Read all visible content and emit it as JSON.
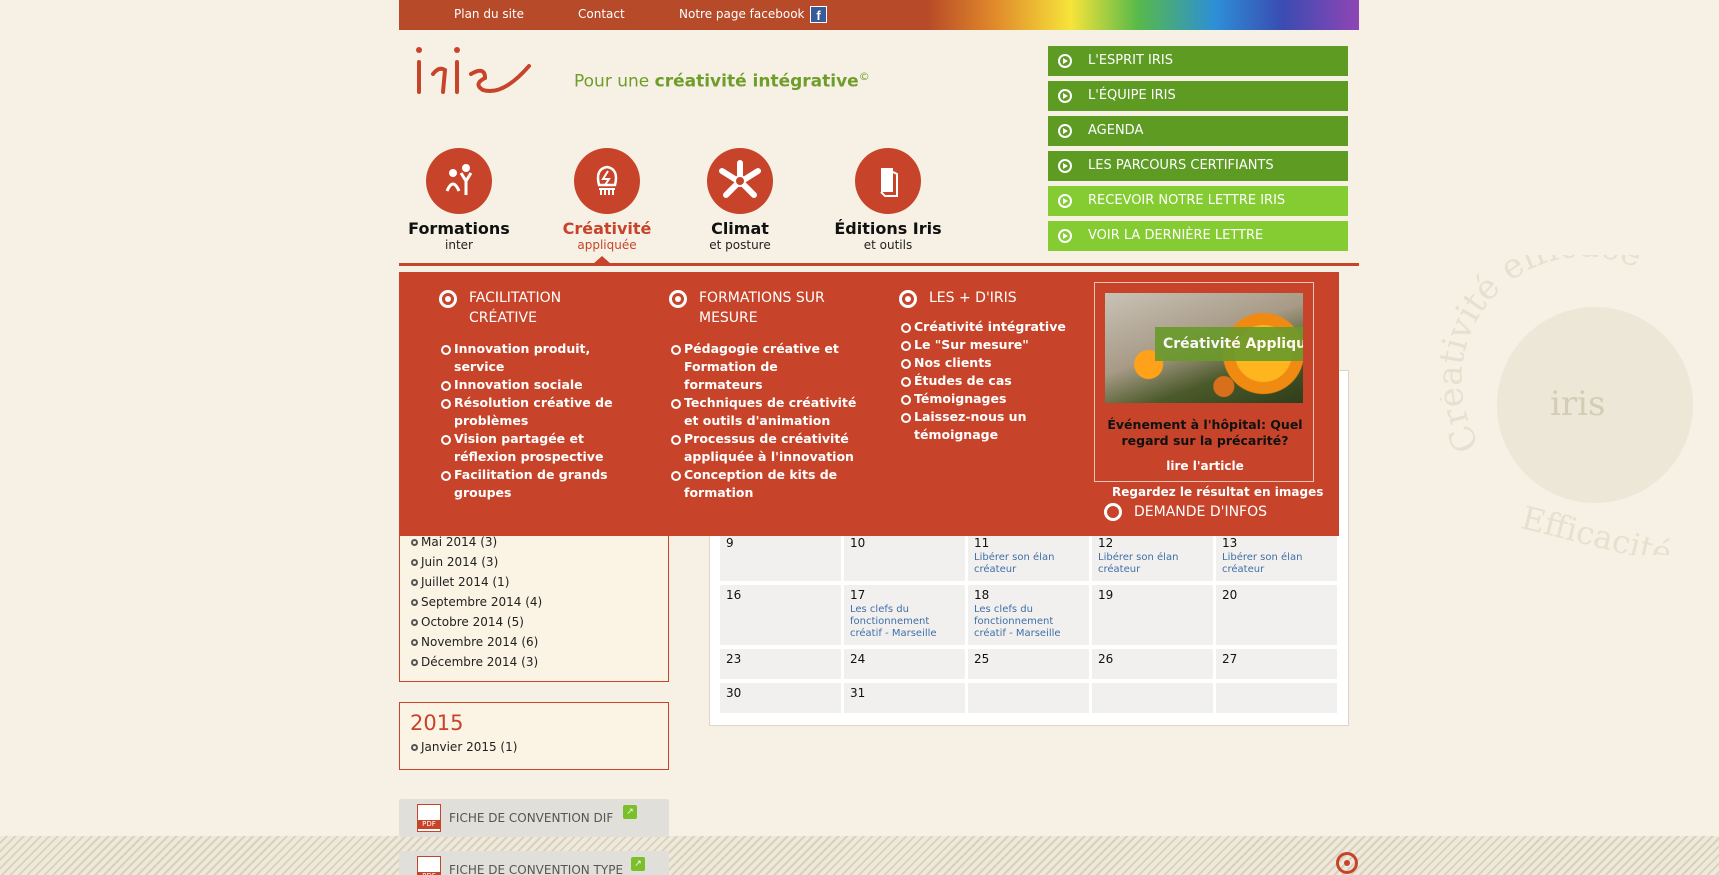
{
  "topbar": {
    "links": [
      "Plan du site",
      "Contact",
      "Notre page facebook"
    ],
    "facebook_icon": "facebook-icon"
  },
  "header": {
    "logo_text": "iris",
    "tagline_prefix": "Pour une ",
    "tagline_bold": "créativité intégrative",
    "tagline_mark": "©"
  },
  "side_menu": [
    {
      "label": "L'ESPRIT IRIS",
      "style": "dark"
    },
    {
      "label": "L'ÉQUIPE IRIS",
      "style": "dark"
    },
    {
      "label": "AGENDA",
      "style": "dark"
    },
    {
      "label": "LES PARCOURS CERTIFIANTS",
      "style": "dark"
    },
    {
      "label": "RECEVOIR NOTRE LETTRE IRIS",
      "style": "light"
    },
    {
      "label": "VOIR LA DERNIÈRE LETTRE",
      "style": "light"
    }
  ],
  "nav": [
    {
      "title": "Formations",
      "sub": "inter",
      "icon": "people-icon"
    },
    {
      "title": "Créativité",
      "sub": "appliquée",
      "icon": "lightbulb-icon",
      "active": true
    },
    {
      "title": "Climat",
      "sub": "et posture",
      "icon": "hands-icon"
    },
    {
      "title": "Éditions Iris",
      "sub": "et outils",
      "icon": "book-icon"
    }
  ],
  "mega": {
    "columns": [
      {
        "title": "FACILITATION CRÉATIVE",
        "items": [
          "Innovation produit, service",
          "Innovation sociale",
          "Résolution créative de problèmes",
          "Vision partagée et réflexion prospective",
          "Facilitation de grands groupes"
        ]
      },
      {
        "title": "FORMATIONS SUR MESURE",
        "items": [
          "Pédagogie créative et Formation de formateurs",
          "Techniques de créativité et outils d'animation",
          "Processus de créativité appliquée à l'innovation",
          "Conception de kits de formation"
        ]
      },
      {
        "title": "LES + D'IRIS",
        "items": [
          "Créativité intégrative",
          "Le \"Sur mesure\"",
          "Nos clients",
          "Études de cas",
          "Témoignages",
          "Laissez-nous un témoignage"
        ]
      }
    ],
    "feature": {
      "tag": "Créativité Appliquée",
      "title": "Événement à l'hôpital: Quel regard sur la précarité?",
      "link": "lire l'article"
    },
    "result_text": "Regardez le résultat en images",
    "demande": "DEMANDE D'INFOS"
  },
  "archive_2014": [
    "Mai 2014 (3)",
    "Juin 2014 (3)",
    "Juillet 2014 (1)",
    "Septembre 2014 (4)",
    "Octobre 2014 (5)",
    "Novembre 2014 (6)",
    "Décembre 2014 (3)"
  ],
  "archive_2015": {
    "year": "2015",
    "items": [
      "Janvier 2015 (1)"
    ]
  },
  "pdf_buttons": [
    "FICHE DE CONVENTION DIF",
    "FICHE DE CONVENTION TYPE"
  ],
  "calendar": {
    "weeks": [
      [
        {
          "d": "9",
          "ev": ""
        },
        {
          "d": "10",
          "ev": ""
        },
        {
          "d": "11",
          "ev": "Libérer son élan créateur"
        },
        {
          "d": "12",
          "ev": "Libérer son élan créateur"
        },
        {
          "d": "13",
          "ev": "Libérer son élan créateur"
        }
      ],
      [
        {
          "d": "16",
          "ev": ""
        },
        {
          "d": "17",
          "ev": "Les clefs du fonctionnement créatif - Marseille"
        },
        {
          "d": "18",
          "ev": "Les clefs du fonctionnement créatif - Marseille"
        },
        {
          "d": "19",
          "ev": ""
        },
        {
          "d": "20",
          "ev": ""
        }
      ],
      [
        {
          "d": "23",
          "ev": ""
        },
        {
          "d": "24",
          "ev": ""
        },
        {
          "d": "25",
          "ev": ""
        },
        {
          "d": "26",
          "ev": ""
        },
        {
          "d": "27",
          "ev": ""
        }
      ],
      [
        {
          "d": "30",
          "ev": ""
        },
        {
          "d": "31",
          "ev": ""
        },
        {
          "d": "",
          "ev": ""
        },
        {
          "d": "",
          "ev": ""
        },
        {
          "d": "",
          "ev": ""
        }
      ]
    ]
  },
  "watermark": {
    "ring_text_top": "efficace",
    "ring_text_left": "Créativité",
    "ring_text_bottom": "Efficacité",
    "center_logo": "iris"
  },
  "colors": {
    "brand_red": "#c7442a",
    "green_dark": "#5d9b22",
    "green_light": "#84cc31",
    "tagline_green": "#6e9d2a"
  }
}
